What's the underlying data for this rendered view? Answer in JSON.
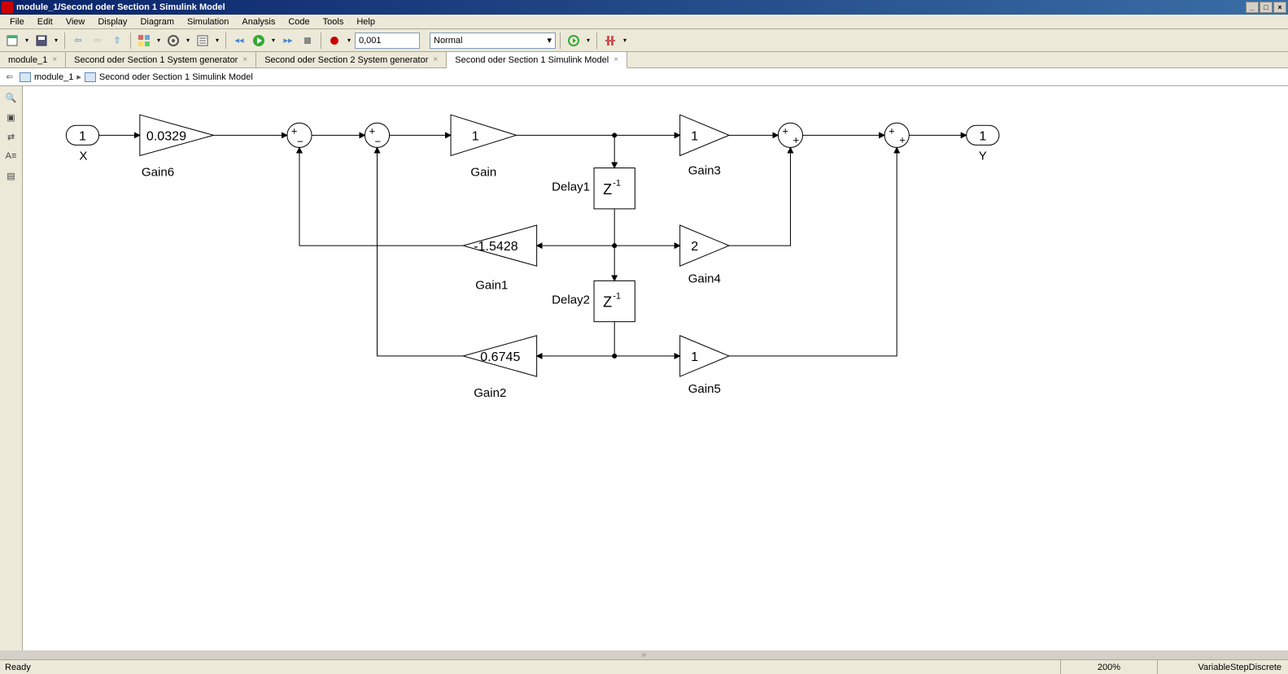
{
  "titlebar": {
    "title": "module_1/Second oder Section 1 Simulink Model"
  },
  "menubar": [
    "File",
    "Edit",
    "View",
    "Display",
    "Diagram",
    "Simulation",
    "Analysis",
    "Code",
    "Tools",
    "Help"
  ],
  "toolbar": {
    "stoptime": "0,001",
    "mode": "Normal"
  },
  "tabs": [
    {
      "label": "module_1",
      "active": false
    },
    {
      "label": "Second oder Section 1 System generator",
      "active": false
    },
    {
      "label": "Second oder Section 2 System generator",
      "active": false
    },
    {
      "label": "Second oder Section 1 Simulink Model",
      "active": true
    }
  ],
  "breadcrumb": {
    "root": "module_1",
    "current": "Second oder Section 1 Simulink Model"
  },
  "statusbar": {
    "left": "Ready",
    "zoom": "200%",
    "solver": "VariableStepDiscrete"
  },
  "blocks": {
    "inport": {
      "value": "1",
      "name": "X"
    },
    "outport": {
      "value": "1",
      "name": "Y"
    },
    "gain6": {
      "value": "0.0329",
      "name": "Gain6"
    },
    "gain": {
      "value": "1",
      "name": "Gain"
    },
    "gain3": {
      "value": "1",
      "name": "Gain3"
    },
    "gain1": {
      "value": "-1.5428",
      "name": "Gain1"
    },
    "gain4": {
      "value": "2",
      "name": "Gain4"
    },
    "gain2": {
      "value": "0.6745",
      "name": "Gain2"
    },
    "gain5": {
      "value": "1",
      "name": "Gain5"
    },
    "delay1": {
      "name": "Delay1",
      "op": "Z",
      "exp": "-1"
    },
    "delay2": {
      "name": "Delay2",
      "op": "Z",
      "exp": "-1"
    },
    "sum_signs": {
      "plus": "+",
      "minus": "−"
    }
  }
}
